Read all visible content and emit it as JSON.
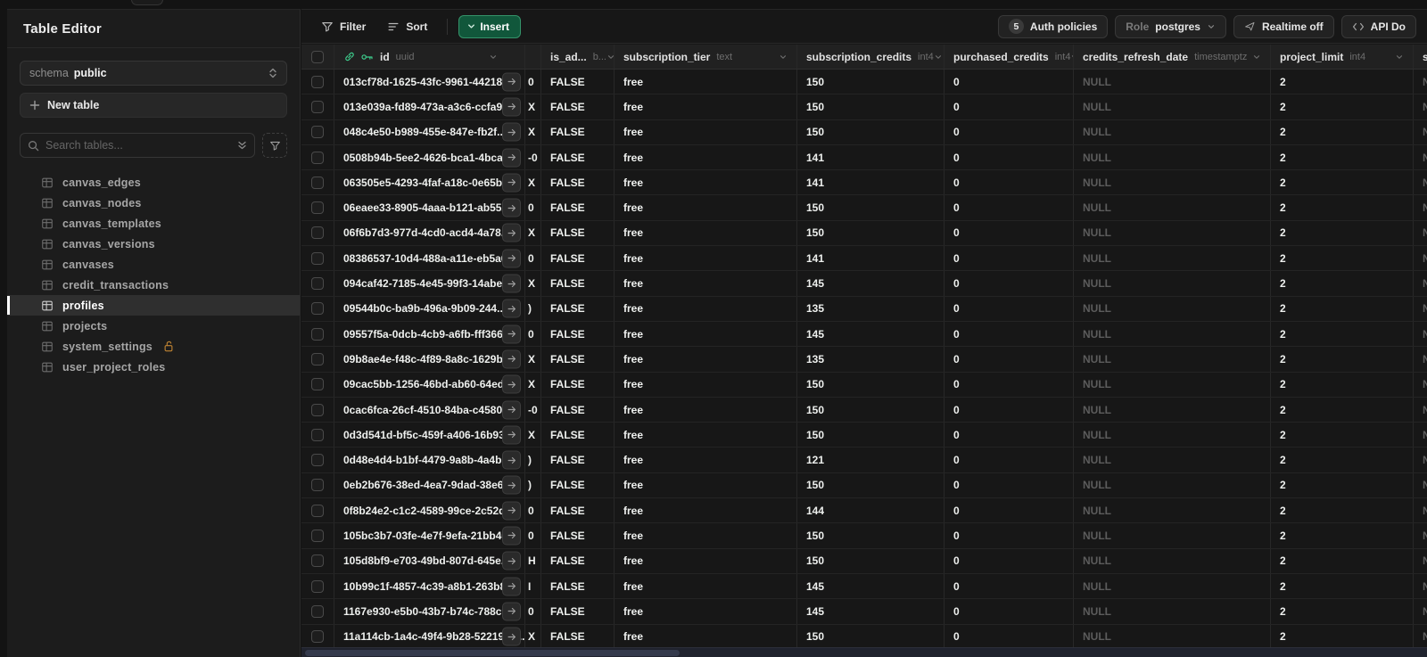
{
  "colors": {
    "background": "#171717",
    "sidebar": "#1c1c1c",
    "brand_green": "#3ecf8e",
    "insert_bg": "#11573b",
    "insert_border": "#35936a",
    "lock_orange": "#c08432",
    "selected_item_bg": "#2f2f2f",
    "null_text": "#5c5c5c"
  },
  "sidebar": {
    "title": "Table Editor",
    "schema_label": "schema",
    "schema_value": "public",
    "new_table_label": "New table",
    "search_placeholder": "Search tables...",
    "tables": [
      {
        "label": "canvas_edges",
        "selected": false,
        "lock": false
      },
      {
        "label": "canvas_nodes",
        "selected": false,
        "lock": false
      },
      {
        "label": "canvas_templates",
        "selected": false,
        "lock": false
      },
      {
        "label": "canvas_versions",
        "selected": false,
        "lock": false
      },
      {
        "label": "canvases",
        "selected": false,
        "lock": false
      },
      {
        "label": "credit_transactions",
        "selected": false,
        "lock": false
      },
      {
        "label": "profiles",
        "selected": true,
        "lock": false
      },
      {
        "label": "projects",
        "selected": false,
        "lock": false
      },
      {
        "label": "system_settings",
        "selected": false,
        "lock": true
      },
      {
        "label": "user_project_roles",
        "selected": false,
        "lock": false
      }
    ]
  },
  "toolbar": {
    "filter_label": "Filter",
    "sort_label": "Sort",
    "insert_label": "Insert",
    "auth_badge": "5",
    "auth_label": "Auth policies",
    "role_label": "Role",
    "role_value": "postgres",
    "realtime_label": "Realtime off",
    "api_label": "API Do"
  },
  "grid": {
    "columns": [
      {
        "key": "id",
        "label": "id",
        "type": "uuid",
        "chevron": true,
        "key_icons": true
      },
      {
        "key": "sliver",
        "label": "",
        "type": "",
        "chevron": false,
        "key_icons": false
      },
      {
        "key": "is_admin",
        "label": "is_ad...",
        "type": "b...",
        "chevron": true,
        "key_icons": false
      },
      {
        "key": "tier",
        "label": "subscription_tier",
        "type": "text",
        "chevron": true,
        "key_icons": false
      },
      {
        "key": "sub_credits",
        "label": "subscription_credits",
        "type": "int4",
        "chevron": true,
        "key_icons": false
      },
      {
        "key": "purchased",
        "label": "purchased_credits",
        "type": "int4",
        "chevron": true,
        "key_icons": false
      },
      {
        "key": "refresh",
        "label": "credits_refresh_date",
        "type": "timestamptz",
        "chevron": true,
        "key_icons": false
      },
      {
        "key": "limit",
        "label": "project_limit",
        "type": "int4",
        "chevron": true,
        "key_icons": false
      },
      {
        "key": "extra",
        "label": "su",
        "type": "",
        "chevron": false,
        "key_icons": false
      }
    ],
    "rows": [
      {
        "id": "013cf78d-1625-43fc-9961-442189...",
        "sliver": "0",
        "is_admin": "FALSE",
        "tier": "free",
        "sub_credits": "150",
        "purchased": "0",
        "refresh": "NULL",
        "limit": "2",
        "extra": "NULL"
      },
      {
        "id": "013e039a-fd89-473a-a3c6-ccfa9...",
        "sliver": "X",
        "is_admin": "FALSE",
        "tier": "free",
        "sub_credits": "150",
        "purchased": "0",
        "refresh": "NULL",
        "limit": "2",
        "extra": "NULL"
      },
      {
        "id": "048c4e50-b989-455e-847e-fb2f...",
        "sliver": "X",
        "is_admin": "FALSE",
        "tier": "free",
        "sub_credits": "150",
        "purchased": "0",
        "refresh": "NULL",
        "limit": "2",
        "extra": "NULL"
      },
      {
        "id": "0508b94b-5ee2-4626-bca1-4bca...",
        "sliver": "-0",
        "is_admin": "FALSE",
        "tier": "free",
        "sub_credits": "141",
        "purchased": "0",
        "refresh": "NULL",
        "limit": "2",
        "extra": "NULL"
      },
      {
        "id": "063505e5-4293-4faf-a18c-0e65b...",
        "sliver": "X",
        "is_admin": "FALSE",
        "tier": "free",
        "sub_credits": "141",
        "purchased": "0",
        "refresh": "NULL",
        "limit": "2",
        "extra": "NULL"
      },
      {
        "id": "06eaee33-8905-4aaa-b121-ab552...",
        "sliver": "0",
        "is_admin": "FALSE",
        "tier": "free",
        "sub_credits": "150",
        "purchased": "0",
        "refresh": "NULL",
        "limit": "2",
        "extra": "NULL"
      },
      {
        "id": "06f6b7d3-977d-4cd0-acd4-4a78...",
        "sliver": "X",
        "is_admin": "FALSE",
        "tier": "free",
        "sub_credits": "150",
        "purchased": "0",
        "refresh": "NULL",
        "limit": "2",
        "extra": "NULL"
      },
      {
        "id": "08386537-10d4-488a-a11e-eb5a6...",
        "sliver": "0",
        "is_admin": "FALSE",
        "tier": "free",
        "sub_credits": "141",
        "purchased": "0",
        "refresh": "NULL",
        "limit": "2",
        "extra": "NULL"
      },
      {
        "id": "094caf42-7185-4e45-99f3-14abee...",
        "sliver": "X",
        "is_admin": "FALSE",
        "tier": "free",
        "sub_credits": "145",
        "purchased": "0",
        "refresh": "NULL",
        "limit": "2",
        "extra": "NULL"
      },
      {
        "id": "09544b0c-ba9b-496a-9b09-244...",
        "sliver": ")",
        "is_admin": "FALSE",
        "tier": "free",
        "sub_credits": "135",
        "purchased": "0",
        "refresh": "NULL",
        "limit": "2",
        "extra": "NULL"
      },
      {
        "id": "09557f5a-0dcb-4cb9-a6fb-fff366...",
        "sliver": "0",
        "is_admin": "FALSE",
        "tier": "free",
        "sub_credits": "145",
        "purchased": "0",
        "refresh": "NULL",
        "limit": "2",
        "extra": "NULL"
      },
      {
        "id": "09b8ae4e-f48c-4f89-8a8c-1629b...",
        "sliver": "X",
        "is_admin": "FALSE",
        "tier": "free",
        "sub_credits": "135",
        "purchased": "0",
        "refresh": "NULL",
        "limit": "2",
        "extra": "NULL"
      },
      {
        "id": "09cac5bb-1256-46bd-ab60-64ed...",
        "sliver": "X",
        "is_admin": "FALSE",
        "tier": "free",
        "sub_credits": "150",
        "purchased": "0",
        "refresh": "NULL",
        "limit": "2",
        "extra": "NULL"
      },
      {
        "id": "0cac6fca-26cf-4510-84ba-c4580...",
        "sliver": "-0",
        "is_admin": "FALSE",
        "tier": "free",
        "sub_credits": "150",
        "purchased": "0",
        "refresh": "NULL",
        "limit": "2",
        "extra": "NULL"
      },
      {
        "id": "0d3d541d-bf5c-459f-a406-16b93...",
        "sliver": "X",
        "is_admin": "FALSE",
        "tier": "free",
        "sub_credits": "150",
        "purchased": "0",
        "refresh": "NULL",
        "limit": "2",
        "extra": "NULL"
      },
      {
        "id": "0d48e4d4-b1bf-4479-9a8b-4a4b...",
        "sliver": ")",
        "is_admin": "FALSE",
        "tier": "free",
        "sub_credits": "121",
        "purchased": "0",
        "refresh": "NULL",
        "limit": "2",
        "extra": "NULL"
      },
      {
        "id": "0eb2b676-38ed-4ea7-9dad-38e6...",
        "sliver": ")",
        "is_admin": "FALSE",
        "tier": "free",
        "sub_credits": "150",
        "purchased": "0",
        "refresh": "NULL",
        "limit": "2",
        "extra": "NULL"
      },
      {
        "id": "0f8b24e2-c1c2-4589-99ce-2c52d...",
        "sliver": "0",
        "is_admin": "FALSE",
        "tier": "free",
        "sub_credits": "144",
        "purchased": "0",
        "refresh": "NULL",
        "limit": "2",
        "extra": "NULL"
      },
      {
        "id": "105bc3b7-03fe-4e7f-9efa-21bb40...",
        "sliver": "0",
        "is_admin": "FALSE",
        "tier": "free",
        "sub_credits": "150",
        "purchased": "0",
        "refresh": "NULL",
        "limit": "2",
        "extra": "NULL"
      },
      {
        "id": "105d8bf9-e703-49bd-807d-645e...",
        "sliver": "H",
        "is_admin": "FALSE",
        "tier": "free",
        "sub_credits": "150",
        "purchased": "0",
        "refresh": "NULL",
        "limit": "2",
        "extra": "NULL"
      },
      {
        "id": "10b99c1f-4857-4c39-a8b1-263b8...",
        "sliver": "I",
        "is_admin": "FALSE",
        "tier": "free",
        "sub_credits": "145",
        "purchased": "0",
        "refresh": "NULL",
        "limit": "2",
        "extra": "NULL"
      },
      {
        "id": "1167e930-e5b0-43b7-b74c-788c9...",
        "sliver": "0",
        "is_admin": "FALSE",
        "tier": "free",
        "sub_credits": "145",
        "purchased": "0",
        "refresh": "NULL",
        "limit": "2",
        "extra": "NULL"
      },
      {
        "id": "11a114cb-1a4c-49f4-9b28-52219ec...",
        "sliver": "X",
        "is_admin": "FALSE",
        "tier": "free",
        "sub_credits": "150",
        "purchased": "0",
        "refresh": "NULL",
        "limit": "2",
        "extra": "NULL"
      }
    ]
  }
}
